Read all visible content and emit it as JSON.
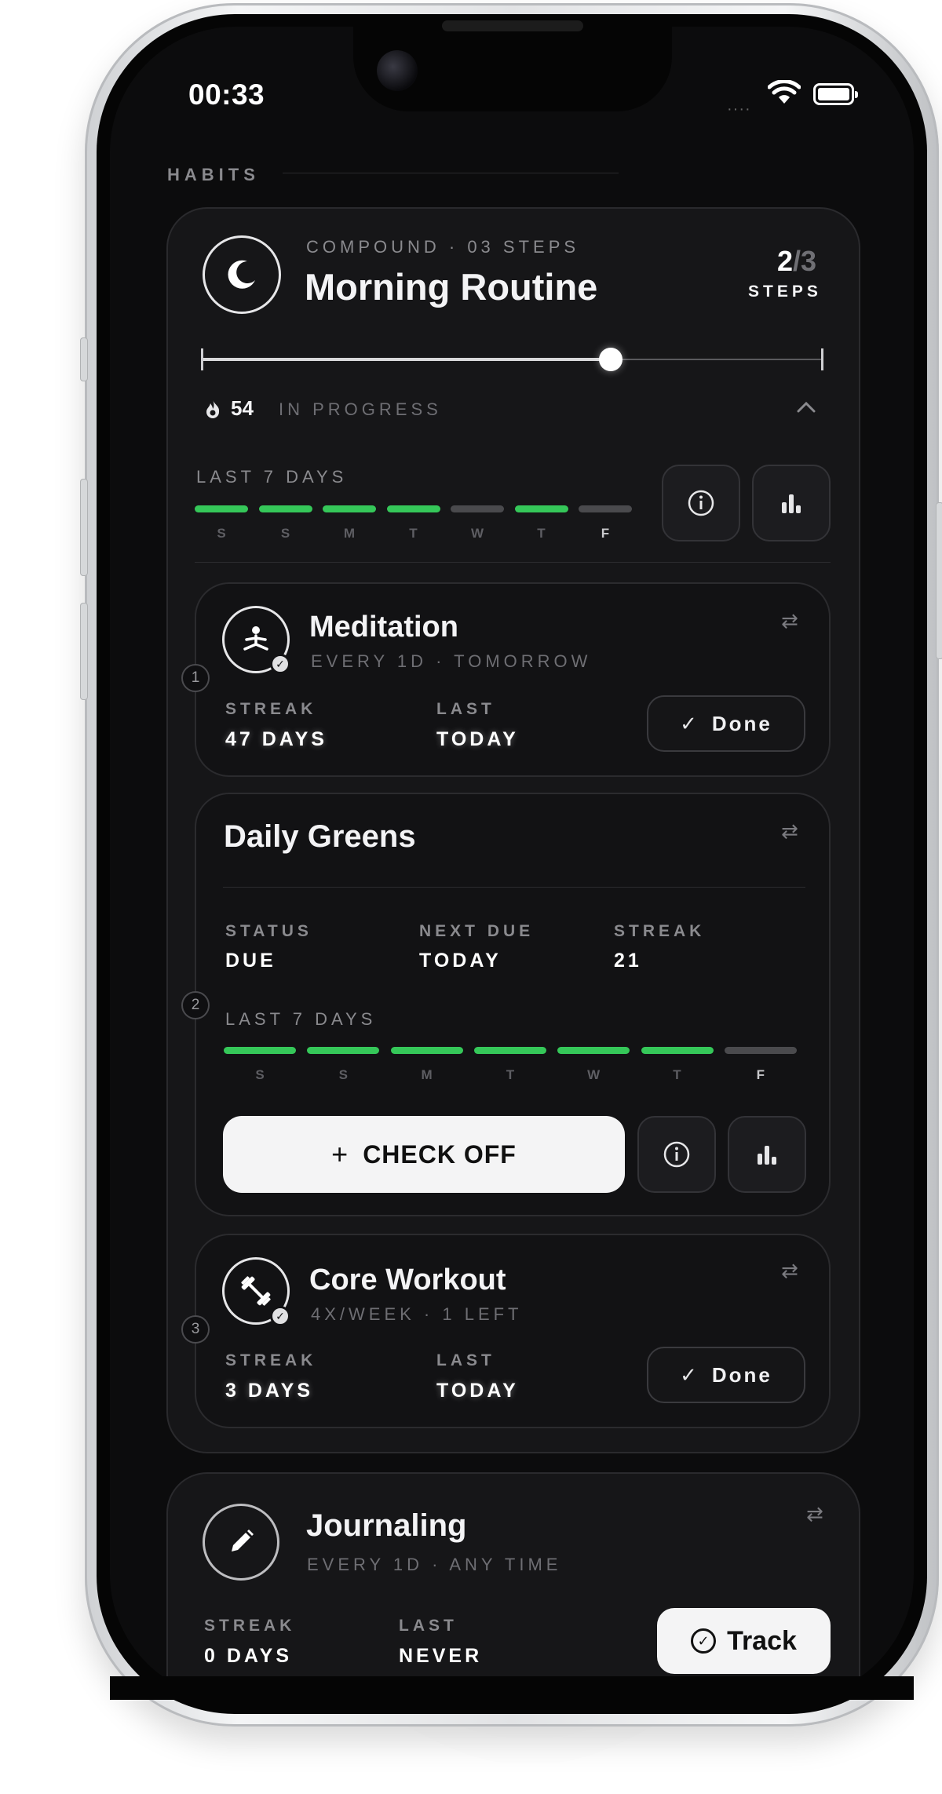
{
  "status_bar": {
    "time": "00:33",
    "signal": "····"
  },
  "section": {
    "label": "HABITS"
  },
  "routine": {
    "kicker": "COMPOUND · 03 STEPS",
    "title": "Morning Routine",
    "steps_done": "2",
    "steps_total": "/3",
    "steps_label": "STEPS",
    "progress_fraction": 0.66,
    "streak": "54",
    "state": "IN PROGRESS",
    "history_label": "LAST 7 DAYS",
    "days": [
      "S",
      "S",
      "M",
      "T",
      "W",
      "T",
      "F"
    ],
    "completed": [
      true,
      true,
      true,
      true,
      false,
      true,
      false
    ]
  },
  "steps": [
    {
      "number": "1",
      "title": "Meditation",
      "schedule": "EVERY 1D · TOMORROW",
      "streak_label": "STREAK",
      "streak_value": "47 DAYS",
      "last_label": "LAST",
      "last_value": "TODAY",
      "action": "Done"
    },
    {
      "number": "2",
      "title": "Daily Greens",
      "status_label": "STATUS",
      "status_value": "DUE",
      "next_label": "NEXT DUE",
      "next_value": "TODAY",
      "streak_label": "STREAK",
      "streak_value": "21",
      "history_label": "LAST 7 DAYS",
      "days": [
        "S",
        "S",
        "M",
        "T",
        "W",
        "T",
        "F"
      ],
      "completed": [
        true,
        true,
        true,
        true,
        true,
        true,
        false
      ],
      "action": "CHECK OFF"
    },
    {
      "number": "3",
      "title": "Core Workout",
      "schedule": "4X/WEEK · 1 LEFT",
      "streak_label": "STREAK",
      "streak_value": "3 DAYS",
      "last_label": "LAST",
      "last_value": "TODAY",
      "action": "Done"
    }
  ],
  "journaling": {
    "title": "Journaling",
    "schedule": "EVERY 1D · ANY TIME",
    "streak_label": "STREAK",
    "streak_value": "0 DAYS",
    "last_label": "LAST",
    "last_value": "NEVER",
    "action": "Track"
  },
  "colors": {
    "accent_green": "#35c759",
    "inactive": "#4a4a4d",
    "background": "#0c0c0d"
  }
}
